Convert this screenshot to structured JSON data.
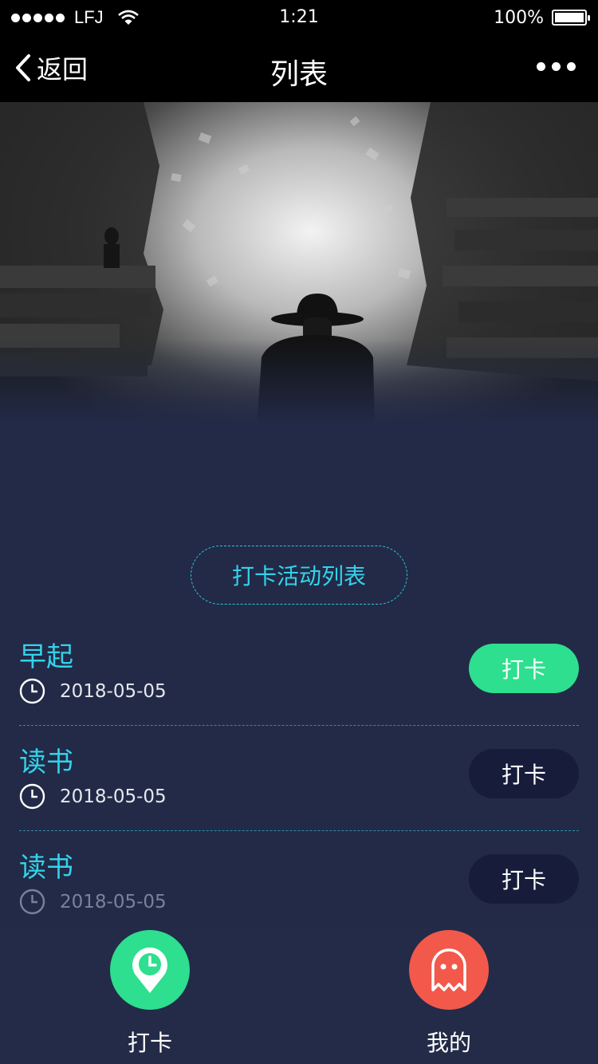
{
  "status_bar": {
    "carrier": "LFJ",
    "time": "1:21",
    "battery": "100%"
  },
  "nav": {
    "back_label": "返回",
    "title": "列表"
  },
  "section": {
    "heading": "打卡活动列表"
  },
  "activities": [
    {
      "title": "早起",
      "date": "2018-05-05",
      "button": "打卡",
      "active": true
    },
    {
      "title": "读书",
      "date": "2018-05-05",
      "button": "打卡",
      "active": false
    },
    {
      "title": "读书",
      "date": "2018-05-05",
      "button": "打卡",
      "active": false
    }
  ],
  "tabs": [
    {
      "label": "打卡",
      "icon": "location-clock-icon",
      "color": "#2ddf8e"
    },
    {
      "label": "我的",
      "icon": "ghost-icon",
      "color": "#f2594b"
    }
  ],
  "colors": {
    "accent": "#33d3ea",
    "active_button": "#2ddf8e",
    "inactive_button": "#161c3a",
    "background": "#222a47"
  }
}
